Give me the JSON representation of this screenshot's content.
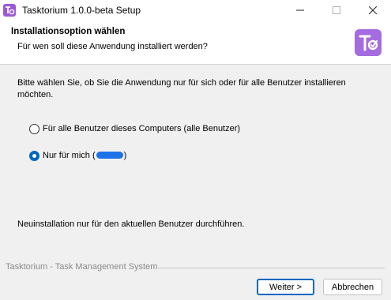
{
  "window": {
    "title": "Tasktorium 1.0.0-beta Setup",
    "icon": "tasktorium-app-icon",
    "controls": {
      "minimize": "—",
      "maximize": "☐",
      "close": "✕"
    }
  },
  "header": {
    "title": "Installationsoption wählen",
    "subtitle": "Für wen soll diese Anwendung installiert werden?",
    "logo": "tasktorium-logo"
  },
  "body": {
    "intro": "Bitte wählen Sie, ob Sie die Anwendung nur für sich oder für alle Benutzer installieren möchten.",
    "options": [
      {
        "label": "Für alle Benutzer dieses Computers (alle Benutzer)",
        "selected": false
      },
      {
        "label_prefix": "Nur für mich (",
        "label_suffix": ")",
        "selected": true,
        "redacted": true
      }
    ],
    "note": "Neuinstallation nur für den aktuellen Benutzer durchführen."
  },
  "footer": {
    "branding": "Tasktorium - Task Management System",
    "next_label": "Weiter >",
    "cancel_label": "Abbrechen"
  },
  "colors": {
    "accent": "#0067c0",
    "logo": "#a56be0",
    "redaction": "#1a73e8"
  }
}
